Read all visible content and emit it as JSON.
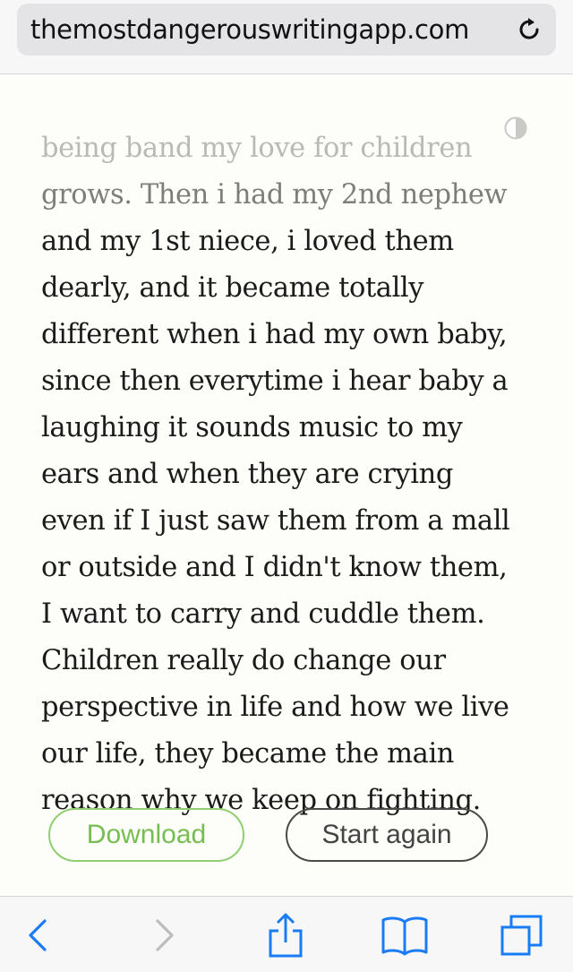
{
  "browser": {
    "url": "themostdangerouswritingapp.com",
    "accent_color": "#1a7cf5"
  },
  "editor": {
    "lines": [
      "being band my love for children",
      "grows. Then i had my 2nd  nephew",
      "and my 1st niece, i loved them",
      "dearly, and it became totally",
      "different when i had my own baby,",
      "since then everytime i hear baby a",
      "laughing it sounds music to my",
      "ears and when they are crying",
      "even if I just saw them from a mall",
      "or outside and I didn't know them,",
      "I want to carry and cuddle them.",
      "Children really do change our",
      "perspective in life and how we live",
      "our life, they became the main",
      "reason why we keep on fighting."
    ],
    "download_label": "Download",
    "start_again_label": "Start again"
  },
  "toolbar": {
    "icons": [
      "back-icon",
      "forward-icon",
      "share-icon",
      "bookmarks-icon",
      "tabs-icon"
    ]
  }
}
